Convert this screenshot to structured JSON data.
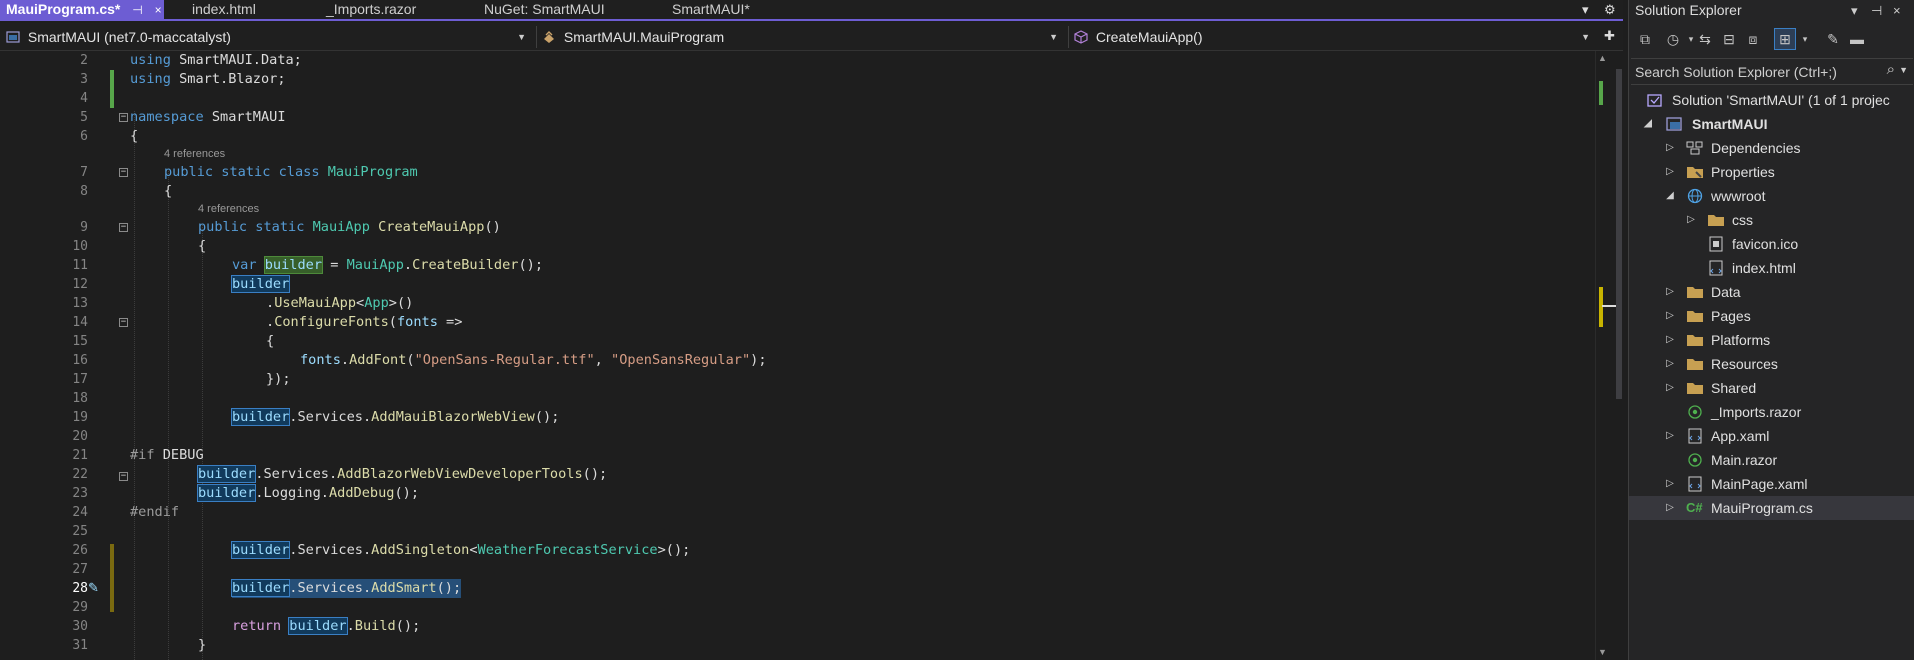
{
  "tabs": [
    {
      "label": "MauiProgram.cs*",
      "active": true
    },
    {
      "label": "index.html"
    },
    {
      "label": "_Imports.razor"
    },
    {
      "label": "NuGet: SmartMAUI"
    },
    {
      "label": "SmartMAUI*"
    }
  ],
  "tab_controls": {
    "pin": "⊣",
    "close": "×",
    "overflow": "▾",
    "settings": "⚙"
  },
  "navbar": {
    "project": "SmartMAUI (net7.0-maccatalyst)",
    "type": "SmartMAUI.MauiProgram",
    "member": "CreateMauiApp()"
  },
  "code": {
    "current_line": "28",
    "references_label": "4 references",
    "lines": [
      {
        "n": "2",
        "t": "using SmartMAUI.Data;"
      },
      {
        "n": "3",
        "t": "using Smart.Blazor;"
      },
      {
        "n": "4",
        "t": ""
      },
      {
        "n": "5",
        "t": "namespace SmartMAUI"
      },
      {
        "n": "6",
        "t": "{"
      },
      {
        "n": "7",
        "t": "public static class MauiProgram"
      },
      {
        "n": "8",
        "t": "{"
      },
      {
        "n": "9",
        "t": "public static MauiApp CreateMauiApp()"
      },
      {
        "n": "10",
        "t": "{"
      },
      {
        "n": "11",
        "t": "var builder = MauiApp.CreateBuilder();"
      },
      {
        "n": "12",
        "t": "builder"
      },
      {
        "n": "13",
        "t": ".UseMauiApp<App>()"
      },
      {
        "n": "14",
        "t": ".ConfigureFonts(fonts =>"
      },
      {
        "n": "15",
        "t": "{"
      },
      {
        "n": "16",
        "t": "fonts.AddFont(\"OpenSans-Regular.ttf\", \"OpenSansRegular\");"
      },
      {
        "n": "17",
        "t": "});"
      },
      {
        "n": "18",
        "t": ""
      },
      {
        "n": "19",
        "t": "builder.Services.AddMauiBlazorWebView();"
      },
      {
        "n": "20",
        "t": ""
      },
      {
        "n": "21",
        "t": "#if DEBUG"
      },
      {
        "n": "22",
        "t": "builder.Services.AddBlazorWebViewDeveloperTools();"
      },
      {
        "n": "23",
        "t": "builder.Logging.AddDebug();"
      },
      {
        "n": "24",
        "t": "#endif"
      },
      {
        "n": "25",
        "t": ""
      },
      {
        "n": "26",
        "t": "builder.Services.AddSingleton<WeatherForecastService>();"
      },
      {
        "n": "27",
        "t": ""
      },
      {
        "n": "28",
        "t": "builder.Services.AddSmart();"
      },
      {
        "n": "29",
        "t": ""
      },
      {
        "n": "30",
        "t": "return builder.Build();"
      },
      {
        "n": "31",
        "t": "}"
      }
    ]
  },
  "solution_explorer": {
    "title": "Solution Explorer",
    "search_placeholder": "Search Solution Explorer (Ctrl+;)",
    "solution_label": "Solution 'SmartMAUI' (1 of 1 projec",
    "project_label": "SmartMAUI",
    "items": [
      "Dependencies",
      "Properties",
      "wwwroot",
      "css",
      "favicon.ico",
      "index.html",
      "Data",
      "Pages",
      "Platforms",
      "Resources",
      "Shared",
      "_Imports.razor",
      "App.xaml",
      "Main.razor",
      "MainPage.xaml",
      "MauiProgram.cs"
    ]
  },
  "colors": {
    "accent": "#6d5dd3",
    "keyword": "#569cd6",
    "type": "#4ec9b0",
    "method": "#dcdcaa",
    "string": "#d69d85",
    "identifier": "#9cdcfe"
  }
}
